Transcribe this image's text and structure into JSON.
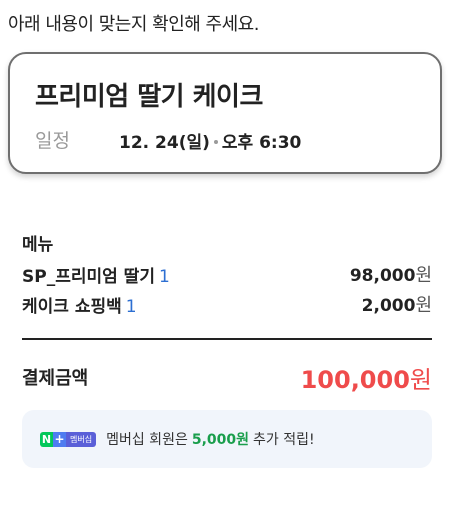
{
  "instruction": "아래 내용이 맞는지 확인해 주세요.",
  "product": {
    "title": "프리미엄 딸기 케이크",
    "schedule_label": "일정",
    "schedule_date": "12. 24(일)",
    "schedule_time": "오후 6:30"
  },
  "menu": {
    "heading": "메뉴",
    "items": [
      {
        "name": "SP_프리미엄 딸기",
        "qty": "1",
        "price": "98,000",
        "unit": "원"
      },
      {
        "name": "케이크 쇼핑백",
        "qty": "1",
        "price": "2,000",
        "unit": "원"
      }
    ]
  },
  "total": {
    "label": "결제금액",
    "amount": "100,000",
    "unit": "원"
  },
  "membership": {
    "badge_n": "N",
    "badge_plus": "+",
    "badge_text": "멤버십",
    "prefix": "멤버십 회원은",
    "points": "5,000원",
    "suffix": "추가 적립!"
  },
  "colors": {
    "accent_red": "#ef4b4b",
    "qty_blue": "#2d6fd2",
    "points_green": "#1a9e4c",
    "membership_bg": "#f1f5fb"
  }
}
